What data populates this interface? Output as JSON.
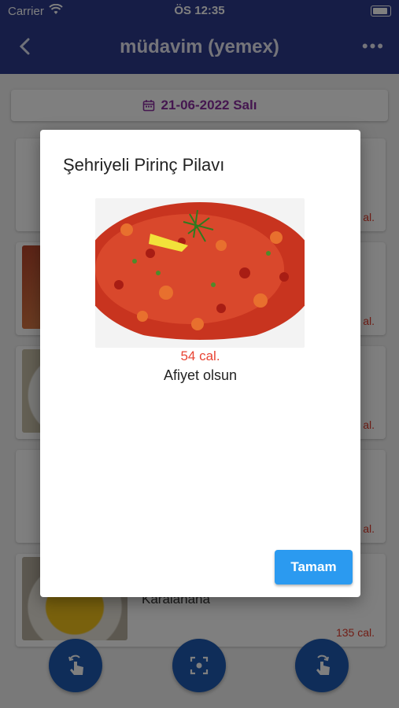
{
  "status": {
    "carrier": "Carrier",
    "time": "ÖS 12:35"
  },
  "appbar": {
    "title": "müdavim (yemex)"
  },
  "date": {
    "label": "21-06-2022 Salı"
  },
  "cards": [
    {
      "cal": "al."
    },
    {
      "cal": "al."
    },
    {
      "cal": "al."
    },
    {
      "cal": "al."
    },
    {
      "name": "Karalahana",
      "cal": "135 cal."
    }
  ],
  "dialog": {
    "title": "Şehriyeli Pirinç Pilavı",
    "cal": "54 cal.",
    "message": "Afiyet olsun",
    "ok_label": "Tamam"
  },
  "colors": {
    "appbar": "#2c3a8c",
    "accent": "#2b9af0",
    "calorie": "#e84333",
    "date": "#8b2fa0"
  }
}
